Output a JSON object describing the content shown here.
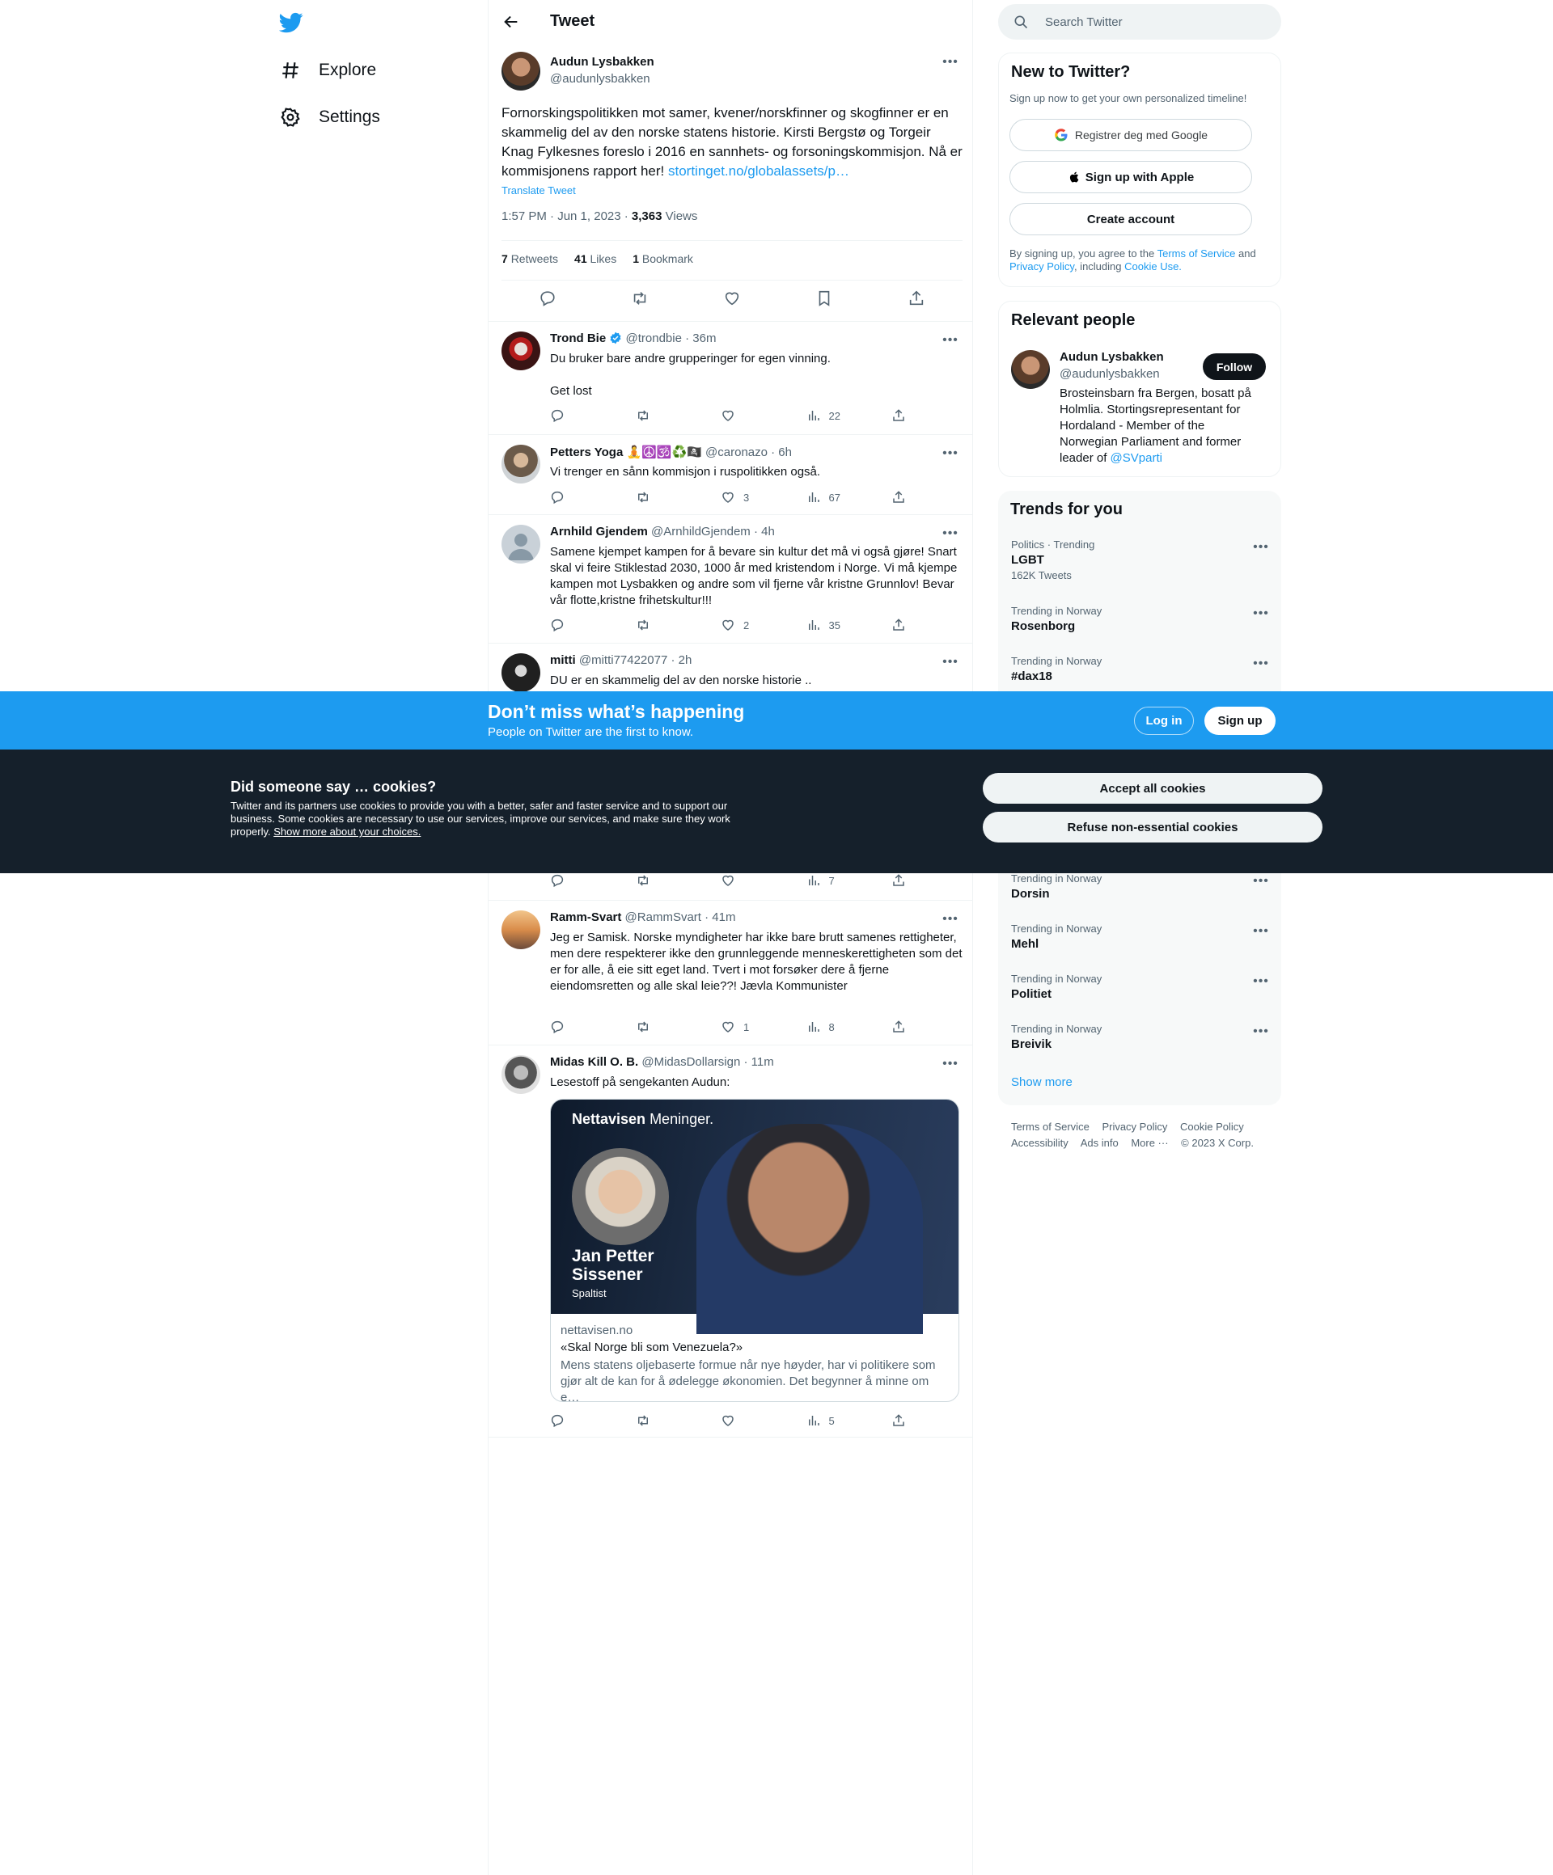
{
  "nav": {
    "explore": "Explore",
    "settings": "Settings"
  },
  "header": {
    "title": "Tweet"
  },
  "main_tweet": {
    "name": "Audun Lysbakken",
    "handle": "@audunlysbakken",
    "text": "Fornorskingspolitikken mot samer, kvener/norskfinner og skogfinner er en skammelig del av den norske statens historie. Kirsti Bergstø og Torgeir Knag Fylkesnes foreslo i 2016 en sannhets- og forsoningskommisjon. Nå er kommisjonens rapport her!",
    "link": "stortinget.no/globalassets/p…",
    "translate": "Translate Tweet",
    "time": "1:57 PM · Jun 1, 2023 · ",
    "views_count": "3,363",
    "views_label": "Views",
    "retweets_count": "7",
    "retweets_label": "Retweets",
    "likes_count": "41",
    "likes_label": "Likes",
    "bookmarks_count": "1",
    "bookmarks_label": "Bookmark"
  },
  "replies": [
    {
      "name": "Trond Bie",
      "handle": "@trondbie · 36m",
      "text1": "Du bruker bare andre grupperinger for egen vinning.",
      "text2": "Get lost",
      "likes": "",
      "views": "22"
    },
    {
      "name": "Petters Yoga 🧘☮️🕉️♻️🏴‍☠️",
      "handle": "@caronazo · 6h",
      "text1": "Vi trenger en sånn kommisjon i ruspolitikken også.",
      "likes": "3",
      "views": "67"
    },
    {
      "name": "Arnhild Gjendem",
      "handle": "@ArnhildGjendem · 4h",
      "text1": "Samene kjempet kampen for å bevare sin kultur det må vi også gjøre! Snart skal vi feire Stiklestad 2030, 1000 år med kristendom i Norge. Vi må kjempe kampen mot Lysbakken og andre som vil fjerne vår kristne Grunnlov! Bevar vår flotte,kristne frihetskultur!!!",
      "likes": "2",
      "views": "35"
    },
    {
      "name": "mitti",
      "handle": "@mitti77422077 · 2h",
      "text1": "DU er en skammelig del av den norske historie .."
    },
    {
      "views": "7"
    },
    {
      "name": "Ramm-Svart",
      "handle": "@RammSvart · 41m",
      "text1": "Jeg er Samisk. Norske myndigheter har ikke bare brutt samenes rettigheter, men dere respekterer ikke den grunnleggende menneskerettigheten som det er for alle, å eie sitt eget land. Tvert i mot forsøker dere å fjerne eiendomsretten og alle skal leie??! Jævla Kommunister",
      "likes": "1",
      "views": "8"
    },
    {
      "name": "Midas Kill O. B.",
      "handle": "@MidasDollarsign · 11m",
      "text1": "Lesestoff på sengekanten Audun:",
      "views": "5"
    }
  ],
  "link_card": {
    "brand": "Nettavisen",
    "brand_sub": "Meninger.",
    "person_name": "Jan Petter Sissener",
    "person_role": "Spaltist",
    "domain": "nettavisen.no",
    "title": "«Skal Norge bli som Venezuela?»",
    "desc": "Mens statens oljebaserte formue når nye høyder, har vi politikere som gjør alt de kan for å ødelegge økonomien. Det begynner å minne om e…"
  },
  "search": {
    "placeholder": "Search Twitter"
  },
  "new_to_twitter": {
    "title": "New to Twitter?",
    "subtitle": "Sign up now to get your own personalized timeline!",
    "google": "Registrer deg med Google",
    "apple": "Sign up with Apple",
    "create": "Create account",
    "legal_pre": "By signing up, you agree to the ",
    "tos": "Terms of Service",
    "and": " and ",
    "privacy": "Privacy Policy",
    "including": ", including ",
    "cookie": "Cookie Use."
  },
  "relevant": {
    "title": "Relevant people",
    "name": "Audun Lysbakken",
    "handle": "@audunlysbakken",
    "follow": "Follow",
    "bio": "Brosteinsbarn fra Bergen, bosatt på Holmlia. Stortingsrepresentant for Hordaland - Member of the Norwegian Parliament and former leader of ",
    "bio_link": "@SVparti"
  },
  "trends": {
    "title": "Trends for you",
    "items": [
      {
        "cat": "Politics · Trending",
        "name": "LGBT",
        "count": "162K Tweets"
      },
      {
        "cat": "Trending in Norway",
        "name": "Rosenborg"
      },
      {
        "cat": "Trending in Norway",
        "name": "#dax18"
      },
      {
        "cat": "Trending in Norway",
        "name": "Dorsin"
      },
      {
        "cat": "Trending in Norway",
        "name": "Mehl"
      },
      {
        "cat": "Trending in Norway",
        "name": "Politiet"
      },
      {
        "cat": "Trending in Norway",
        "name": "Breivik"
      }
    ],
    "show_more": "Show more"
  },
  "footer": {
    "tos": "Terms of Service",
    "privacy": "Privacy Policy",
    "cookie": "Cookie Policy",
    "accessibility": "Accessibility",
    "ads": "Ads info",
    "more": "More ···",
    "copyright": "© 2023 X Corp."
  },
  "banner": {
    "title": "Don’t miss what’s happening",
    "subtitle": "People on Twitter are the first to know.",
    "login": "Log in",
    "signup": "Sign up"
  },
  "cookies": {
    "title": "Did someone say … cookies?",
    "text": "Twitter and its partners use cookies to provide you with a better, safer and faster service and to support our business. Some cookies are necessary to use our services, improve our services, and make sure they work properly. ",
    "link": "Show more about your choices.",
    "accept": "Accept all cookies",
    "refuse": "Refuse non-essential cookies"
  },
  "colors": {
    "accent": "#1d9bf0",
    "dark": "#15202b",
    "text": "#0f1419",
    "muted": "#536471"
  }
}
